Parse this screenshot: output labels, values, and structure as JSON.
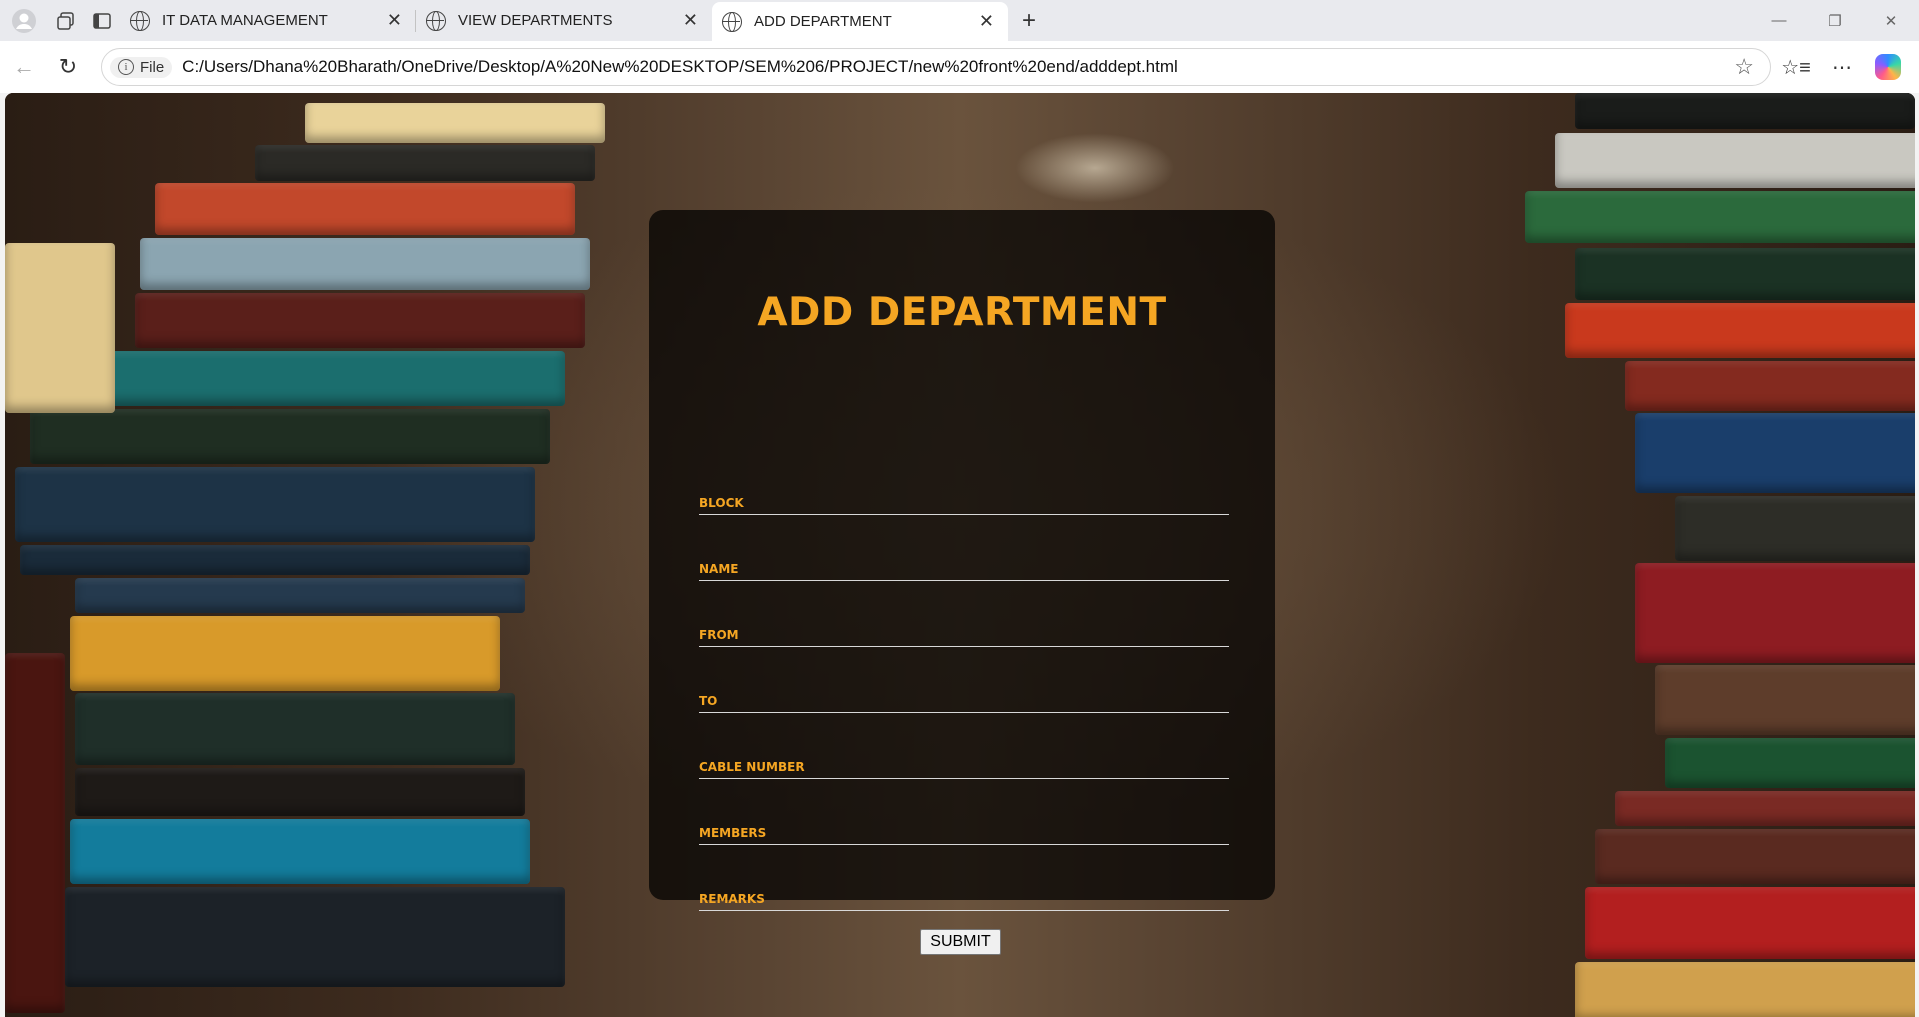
{
  "browser": {
    "tabs": [
      {
        "title": "IT DATA MANAGEMENT"
      },
      {
        "title": "VIEW DEPARTMENTS"
      },
      {
        "title": "ADD DEPARTMENT"
      }
    ],
    "address": {
      "scheme_label": "File",
      "url": "C:/Users/Dhana%20Bharath/OneDrive/Desktop/A%20New%20DESKTOP/SEM%206/PROJECT/new%20front%20end/adddept.html"
    }
  },
  "form": {
    "title": "ADD DEPARTMENT",
    "fields": [
      {
        "label": "BLOCK",
        "value": ""
      },
      {
        "label": "NAME",
        "value": ""
      },
      {
        "label": "FROM",
        "value": ""
      },
      {
        "label": "TO",
        "value": ""
      },
      {
        "label": "CABLE NUMBER",
        "value": ""
      },
      {
        "label": "MEMBERS",
        "value": ""
      },
      {
        "label": "REMARKS",
        "value": ""
      }
    ],
    "submit_label": "SUBMIT"
  },
  "colors": {
    "accent": "#f5a623",
    "card_background": "rgba(0,0,0,0.72)"
  }
}
